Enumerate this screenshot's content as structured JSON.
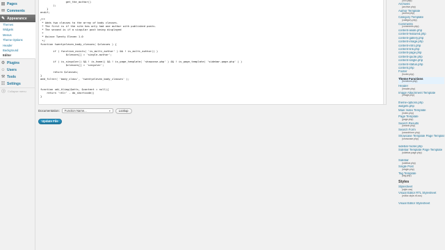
{
  "sidebar": {
    "top_items": [
      {
        "label": "Pages",
        "icon": "pages-icon"
      },
      {
        "label": "Comments",
        "icon": "comments-icon"
      }
    ],
    "appearance": {
      "label": "Appearance",
      "icon": "appearance-icon",
      "submenu": [
        "Themes",
        "Widgets",
        "Menus",
        "Theme Options",
        "Header",
        "Background",
        "Editor"
      ]
    },
    "bottom_items": [
      {
        "label": "Plugins",
        "icon": "plugins-icon"
      },
      {
        "label": "Users",
        "icon": "users-icon"
      },
      {
        "label": "Tools",
        "icon": "tools-icon"
      },
      {
        "label": "Settings",
        "icon": "settings-icon"
      }
    ],
    "collapse_label": "Collapse menu"
  },
  "editor": {
    "code_lines": [
      "                get_the_author()",
      "        );",
      "    }",
      "endif;",
      "",
      "/**",
      " * Adds two classes to the array of body classes.",
      " * The first is if the site has only had one author with published posts.",
      " * The second is if a singular post being displayed",
      " *",
      " * @since Twenty Eleven 1.0",
      " */",
      "function twentyeleven_body_classes( $classes ) {",
      "",
      "        if ( function_exists( 'is_multi_author' ) && ! is_multi_author() )",
      "                $classes[] = 'single-author';",
      "",
      "        if ( is_singular() && ! is_home() && ! is_page_template( 'showcase.php' ) && ! is_page_template( 'sidebar-page.php' ) )",
      "                $classes[] = 'singular';",
      "",
      "        return $classes;",
      "}",
      "add_filter( 'body_class', 'twentyeleven_body_classes' );",
      "",
      "",
      "function udi_hlimg($atts, $content = null){",
      "    return '<hl>' . do_shortcode()",
      "}"
    ]
  },
  "documentation": {
    "label": "Documentation:",
    "select_value": "Function Name...",
    "lookup_button": "Lookup"
  },
  "update_button": "Update File",
  "files": [
    {
      "name": "",
      "file": "(404.php)"
    },
    {
      "name": "Archives",
      "file": "(archive.php)"
    },
    {
      "name": "Author Template",
      "file": "(author.php)"
    },
    {
      "name": "Category Template",
      "file": "(category.php)"
    },
    {
      "name": "Comments",
      "file": "(comments.php)"
    },
    {
      "name": "content-aside.php",
      "file": ""
    },
    {
      "name": "content-featured.php",
      "file": ""
    },
    {
      "name": "content-gallery.php",
      "file": ""
    },
    {
      "name": "content-image.php",
      "file": ""
    },
    {
      "name": "content-intro.php",
      "file": ""
    },
    {
      "name": "content-link.php",
      "file": ""
    },
    {
      "name": "content-page.php",
      "file": ""
    },
    {
      "name": "content-quote.php",
      "file": ""
    },
    {
      "name": "content-single.php",
      "file": ""
    },
    {
      "name": "content-status.php",
      "file": ""
    },
    {
      "name": "content.php",
      "file": ""
    },
    {
      "name": "Footer",
      "file": "(footer.php)"
    },
    {
      "name": "Theme Functions",
      "file": "(functions.php)",
      "active": true
    },
    {
      "name": "Header",
      "file": "(header.php)"
    },
    {
      "name": "Image Attachment Template",
      "file": "(image.php)"
    },
    {
      "name": "theme-options.php",
      "file": ""
    },
    {
      "name": "widgets.php",
      "file": ""
    },
    {
      "name": "Main Index Template",
      "file": "(index.php)"
    },
    {
      "name": "Page Template",
      "file": "(page.php)"
    },
    {
      "name": "Search Results",
      "file": "(search.php)"
    },
    {
      "name": "Search Form",
      "file": "(searchform.php)"
    },
    {
      "name": "Showcase Template Page Template",
      "file": "(showcase.php)"
    },
    {
      "name": "sidebar-footer.php",
      "file": ""
    },
    {
      "name": "Sidebar Template Page Template",
      "file": "(sidebar-page.php)"
    },
    {
      "name": "Sidebar",
      "file": "(sidebar.php)"
    },
    {
      "name": "Single Post",
      "file": "(single.php)"
    },
    {
      "name": "Tag Template",
      "file": "(tag.php)"
    }
  ],
  "styles_heading": "Styles",
  "style_files": [
    {
      "name": "Stylesheet",
      "file": "(style.css)"
    },
    {
      "name": "Visual Editor RTL Stylesheet",
      "file": "(editor-style-rtl.css)"
    },
    {
      "name": "Visual Editor Stylesheet",
      "file": ""
    }
  ]
}
